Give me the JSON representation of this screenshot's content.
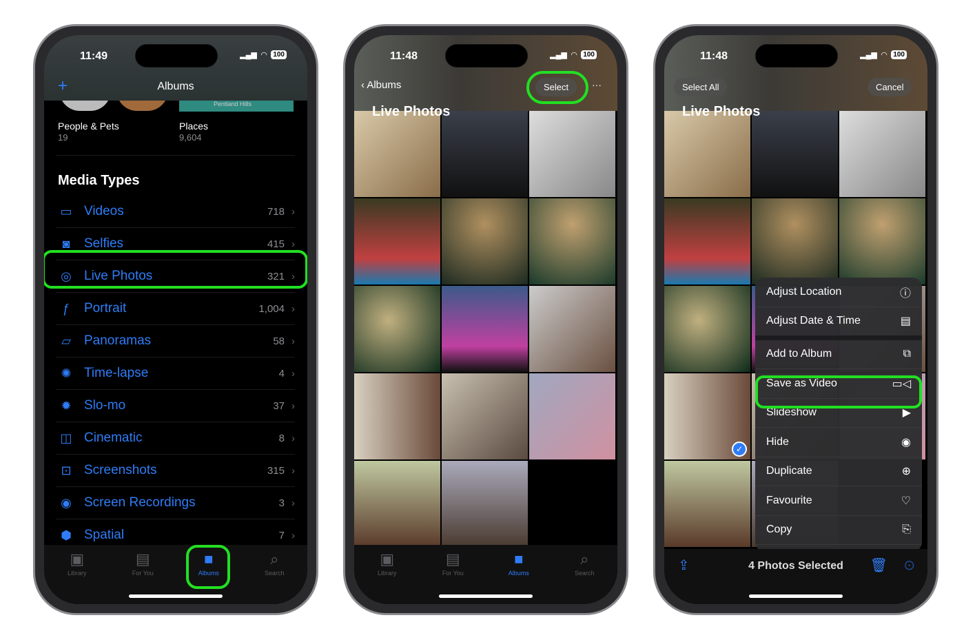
{
  "phone1": {
    "time": "11:49",
    "battery": "100",
    "nav_title": "Albums",
    "add_icon": "plus-icon",
    "people": {
      "label": "People & Pets",
      "count": "19"
    },
    "places": {
      "label": "Places",
      "count": "9,604",
      "map_label": "Pentland Hills"
    },
    "section": "Media Types",
    "items": [
      {
        "label": "Videos",
        "count": "718",
        "icon": "▭"
      },
      {
        "label": "Selfies",
        "count": "415",
        "icon": "◙"
      },
      {
        "label": "Live Photos",
        "count": "321",
        "icon": "◎"
      },
      {
        "label": "Portrait",
        "count": "1,004",
        "icon": "ƒ"
      },
      {
        "label": "Panoramas",
        "count": "58",
        "icon": "▱"
      },
      {
        "label": "Time-lapse",
        "count": "4",
        "icon": "✺"
      },
      {
        "label": "Slo-mo",
        "count": "37",
        "icon": "✹"
      },
      {
        "label": "Cinematic",
        "count": "8",
        "icon": "◫"
      },
      {
        "label": "Screenshots",
        "count": "315",
        "icon": "⊡"
      },
      {
        "label": "Screen Recordings",
        "count": "3",
        "icon": "◉"
      },
      {
        "label": "Spatial",
        "count": "7",
        "icon": "⬢"
      }
    ]
  },
  "tabs": [
    {
      "label": "Library",
      "icon": "▣"
    },
    {
      "label": "For You",
      "icon": "▤"
    },
    {
      "label": "Albums",
      "icon": "■"
    },
    {
      "label": "Search",
      "icon": "⌕"
    }
  ],
  "phone2": {
    "time": "11:48",
    "battery": "100",
    "back_label": "Albums",
    "select_label": "Select",
    "more": "···",
    "title": "Live Photos"
  },
  "phone3": {
    "time": "11:48",
    "battery": "100",
    "select_all": "Select All",
    "cancel": "Cancel",
    "title": "Live Photos",
    "menu": [
      {
        "label": "Adjust Location",
        "icon": "ⓘ"
      },
      {
        "label": "Adjust Date & Time",
        "icon": "▤"
      },
      {
        "label": "Add to Album",
        "icon": "⧉"
      },
      {
        "label": "Save as Video",
        "icon": "▭◁"
      },
      {
        "label": "Slideshow",
        "icon": "▶"
      },
      {
        "label": "Hide",
        "icon": "◉"
      },
      {
        "label": "Duplicate",
        "icon": "⊕"
      },
      {
        "label": "Favourite",
        "icon": "♡"
      },
      {
        "label": "Copy",
        "icon": "⎘"
      }
    ],
    "selected_text": "4 Photos Selected"
  },
  "colors": {
    "accent": "#2f7cf6",
    "highlight": "#22e022"
  }
}
